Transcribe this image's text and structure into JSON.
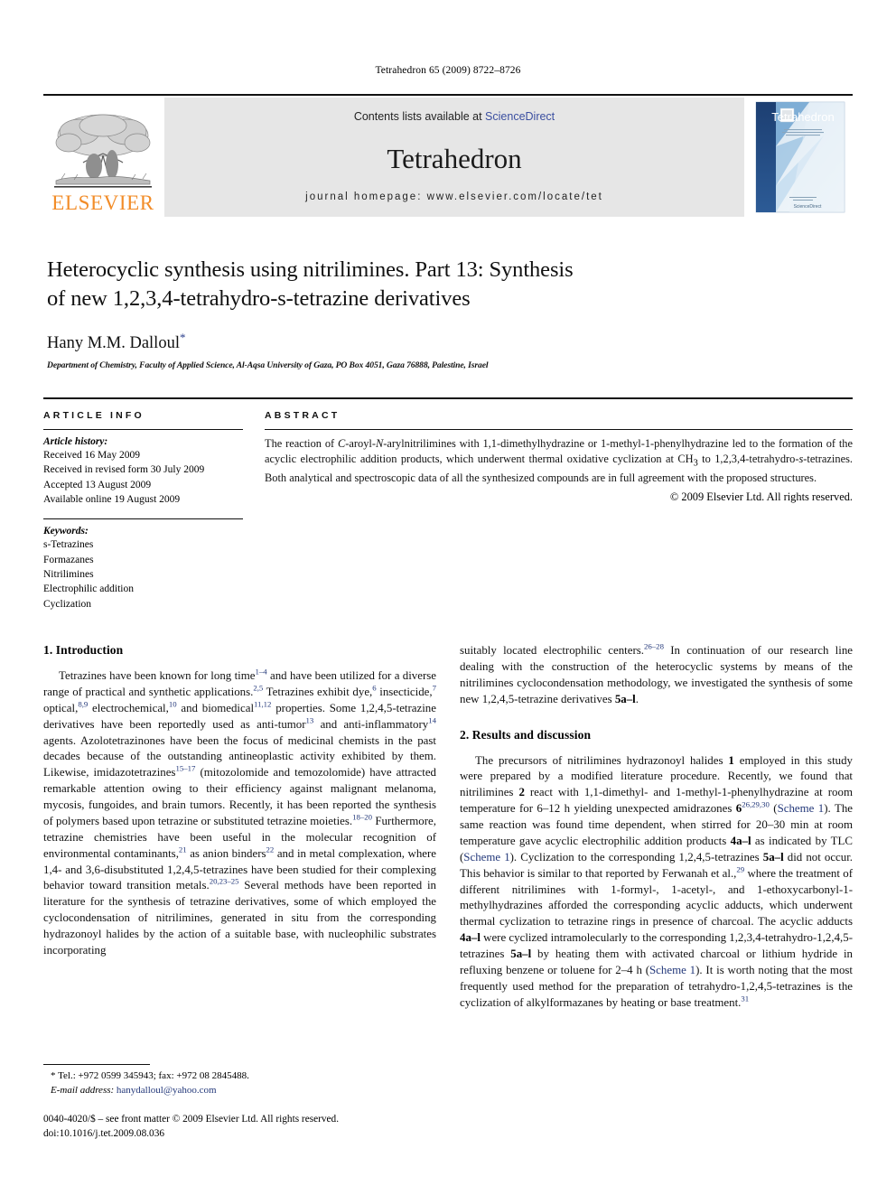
{
  "running_head": "Tetrahedron 65 (2009) 8722–8726",
  "masthead": {
    "publisher_logo_text": "ELSEVIER",
    "contents_prefix": "Contents lists available at ",
    "contents_link": "ScienceDirect",
    "journal_name": "Tetrahedron",
    "homepage_line": "journal homepage: www.elsevier.com/locate/tet",
    "cover_title": "Tetrahedron",
    "cover_subtitle": "The International Journal for the Rapid Publication of Full Original Research Papers and Critical Reviews in Organic Chemistry",
    "cover_footer": "ScienceDirect",
    "link_color": "#3b4fa0",
    "elsevier_orange": "#F28C28"
  },
  "article": {
    "title_line1": "Heterocyclic synthesis using nitrilimines. Part 13: Synthesis",
    "title_line2": "of new 1,2,3,4-tetrahydro-s-tetrazine derivatives",
    "author": "Hany M.M. Dalloul",
    "author_marker": "*",
    "affiliation": "Department of Chemistry, Faculty of Applied Science, Al-Aqsa University of Gaza, PO Box 4051, Gaza 76888, Palestine, Israel"
  },
  "article_info": {
    "heading": "ARTICLE INFO",
    "history_label": "Article history:",
    "history": [
      "Received 16 May 2009",
      "Received in revised form 30 July 2009",
      "Accepted 13 August 2009",
      "Available online 19 August 2009"
    ],
    "keywords_label": "Keywords:",
    "keywords": [
      "s-Tetrazines",
      "Formazanes",
      "Nitrilimines",
      "Electrophilic addition",
      "Cyclization"
    ]
  },
  "abstract": {
    "heading": "ABSTRACT",
    "text": "The reaction of C-aroyl-N-arylnitrilimines with 1,1-dimethylhydrazine or 1-methyl-1-phenylhydrazine led to the formation of the acyclic electrophilic addition products, which underwent thermal oxidative cyclization at CH3 to 1,2,3,4-tetrahydro-s-tetrazines. Both analytical and spectroscopic data of all the synthesized compounds are in full agreement with the proposed structures.",
    "copyright": "© 2009 Elsevier Ltd. All rights reserved."
  },
  "sections": {
    "intro_heading": "1. Introduction",
    "results_heading": "2. Results and discussion"
  },
  "footnote": {
    "marker": "*",
    "tel_fax": "Tel.: +972 0599 345943; fax: +972 08 2845488.",
    "email_label": "E-mail address:",
    "email": "hanydalloul@yahoo.com"
  },
  "footer": {
    "issn_line": "0040-4020/$ – see front matter © 2009 Elsevier Ltd. All rights reserved.",
    "doi_line": "doi:10.1016/j.tet.2009.08.036"
  }
}
